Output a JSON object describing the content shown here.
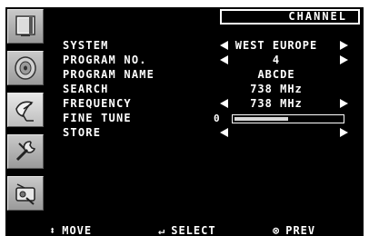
{
  "header": {
    "title": "CHANNEL"
  },
  "sidebar": {
    "items": [
      {
        "icon": "tv-picture-icon"
      },
      {
        "icon": "speaker-sound-icon"
      },
      {
        "icon": "satellite-dish-channel-icon"
      },
      {
        "icon": "wrench-setup-icon"
      },
      {
        "icon": "settings-tools-icon"
      }
    ]
  },
  "menu": {
    "system": {
      "label": "SYSTEM",
      "value": "WEST EUROPE"
    },
    "program_no": {
      "label": "PROGRAM NO.",
      "value": "4"
    },
    "program_name": {
      "label": "PROGRAM NAME",
      "value": "ABCDE"
    },
    "search": {
      "label": "SEARCH",
      "value": "738 MHz"
    },
    "frequency": {
      "label": "FREQUENCY",
      "value": "738 MHz"
    },
    "fine_tune": {
      "label": "FINE TUNE",
      "min_label": "0",
      "level": 0.5
    },
    "store": {
      "label": "STORE"
    }
  },
  "footer": {
    "move": {
      "symbol": "⬍",
      "label": "MOVE"
    },
    "select": {
      "symbol": "↵",
      "label": "SELECT"
    },
    "prev": {
      "symbol": "⊗",
      "label": "PREV"
    }
  },
  "colors": {
    "background": "#000000",
    "text": "#ffffff",
    "tab": "#b0b0b0"
  }
}
